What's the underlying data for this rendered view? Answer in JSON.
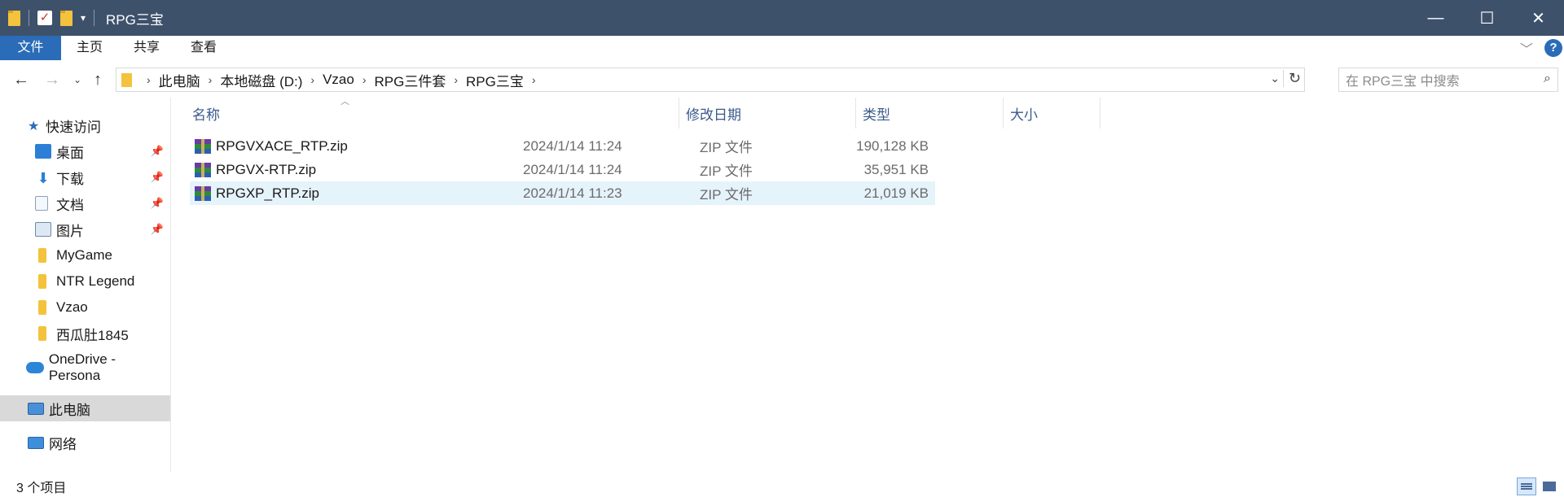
{
  "window": {
    "title": "RPG三宝"
  },
  "ribbon": {
    "tabs": [
      "文件",
      "主页",
      "共享",
      "查看"
    ]
  },
  "address": {
    "crumbs": [
      "此电脑",
      "本地磁盘 (D:)",
      "Vzao",
      "RPG三件套",
      "RPG三宝"
    ],
    "search_placeholder": "在 RPG三宝 中搜索"
  },
  "sidebar": {
    "items": [
      {
        "label": "快速访问",
        "icon": "star-icon",
        "pinned": false
      },
      {
        "label": "桌面",
        "icon": "desktop-icon",
        "pinned": true
      },
      {
        "label": "下载",
        "icon": "download-icon",
        "pinned": true
      },
      {
        "label": "文档",
        "icon": "document-icon",
        "pinned": true
      },
      {
        "label": "图片",
        "icon": "pictures-icon",
        "pinned": true
      },
      {
        "label": "MyGame",
        "icon": "folder-icon",
        "pinned": false
      },
      {
        "label": "NTR Legend",
        "icon": "folder-icon",
        "pinned": false
      },
      {
        "label": "Vzao",
        "icon": "folder-icon",
        "pinned": false
      },
      {
        "label": "西瓜肚1845",
        "icon": "folder-icon",
        "pinned": false
      },
      {
        "label": "OneDrive - Persona",
        "icon": "cloud-icon",
        "pinned": false
      },
      {
        "label": "此电脑",
        "icon": "computer-icon",
        "pinned": false
      },
      {
        "label": "网络",
        "icon": "network-icon",
        "pinned": false
      }
    ]
  },
  "columns": {
    "name": "名称",
    "date": "修改日期",
    "type": "类型",
    "size": "大小"
  },
  "files": [
    {
      "name": "RPGVXACE_RTP.zip",
      "date": "2024/1/14 11:24",
      "type": "ZIP 文件",
      "size": "190,128 KB"
    },
    {
      "name": "RPGVX-RTP.zip",
      "date": "2024/1/14 11:24",
      "type": "ZIP 文件",
      "size": "35,951 KB"
    },
    {
      "name": "RPGXP_RTP.zip",
      "date": "2024/1/14 11:23",
      "type": "ZIP 文件",
      "size": "21,019 KB"
    }
  ],
  "status": {
    "count": "3 个项目"
  },
  "colors": {
    "titlebar": "#3e516b",
    "accent": "#2a6cb8",
    "selection": "#e5f3fb"
  }
}
